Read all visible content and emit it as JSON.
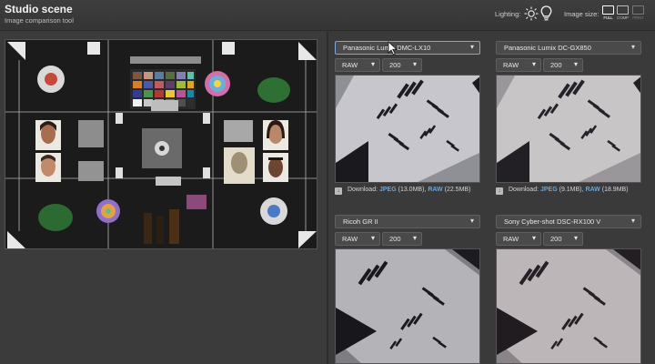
{
  "header": {
    "title": "Studio scene",
    "subtitle": "Image comparison tool",
    "lighting_label": "Lighting:",
    "image_size_label": "Image size:",
    "size_options": [
      "FULL",
      "COMP",
      "PRINT"
    ]
  },
  "panels": [
    {
      "camera": "Panasonic Lumix DMC-LX10",
      "format": "RAW",
      "iso": "200",
      "download": {
        "prefix": "Download:",
        "jpeg": "JPEG",
        "jpeg_size": "(13.0MB)",
        "sep": ",",
        "raw": "RAW",
        "raw_size": "(22.5MB)"
      }
    },
    {
      "camera": "Panasonic Lumix DC-GX850",
      "format": "RAW",
      "iso": "200",
      "download": {
        "prefix": "Download:",
        "jpeg": "JPEG",
        "jpeg_size": "(9.1MB)",
        "sep": ",",
        "raw": "RAW",
        "raw_size": "(18.9MB)"
      }
    },
    {
      "camera": "Ricoh GR II",
      "format": "RAW",
      "iso": "200"
    },
    {
      "camera": "Sony Cyber-shot DSC-RX100 V",
      "format": "RAW",
      "iso": "200"
    }
  ],
  "colors": {
    "accent_link": "#5da9e9",
    "background": "#3a3a3a",
    "active_select_border": "#7aa7d6"
  },
  "icons": {
    "chevron": "▾",
    "download": "↓"
  }
}
